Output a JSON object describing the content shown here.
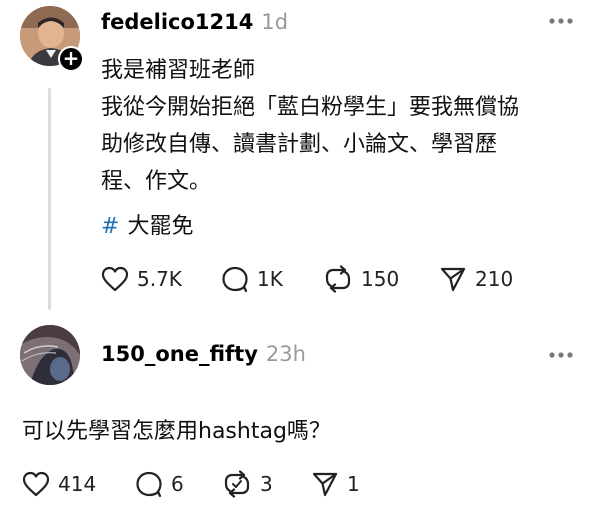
{
  "post": {
    "username": "fedelico1214",
    "time": "1d",
    "lines": [
      "我是補習班老師",
      "我從今開始拒絕「藍白粉學生」要我無償協",
      "助修改自傳、讀書計劃、小論文、學習歷",
      "程、作文。"
    ],
    "hashtag": "大罷免",
    "hashtag_symbol": "#",
    "follow_symbol": "+",
    "likes": "5.7K",
    "comments": "1K",
    "reposts": "150",
    "shares": "210"
  },
  "reply": {
    "username": "150_one_fifty",
    "time": "23h",
    "text": "可以先學習怎麼用hashtag嗎？",
    "likes": "414",
    "comments": "6",
    "reposts": "3",
    "shares": "1"
  },
  "colors": {
    "hashtag": "#1e73b8",
    "time": "#9a9a9a",
    "thread_line": "#dcdcdc"
  }
}
